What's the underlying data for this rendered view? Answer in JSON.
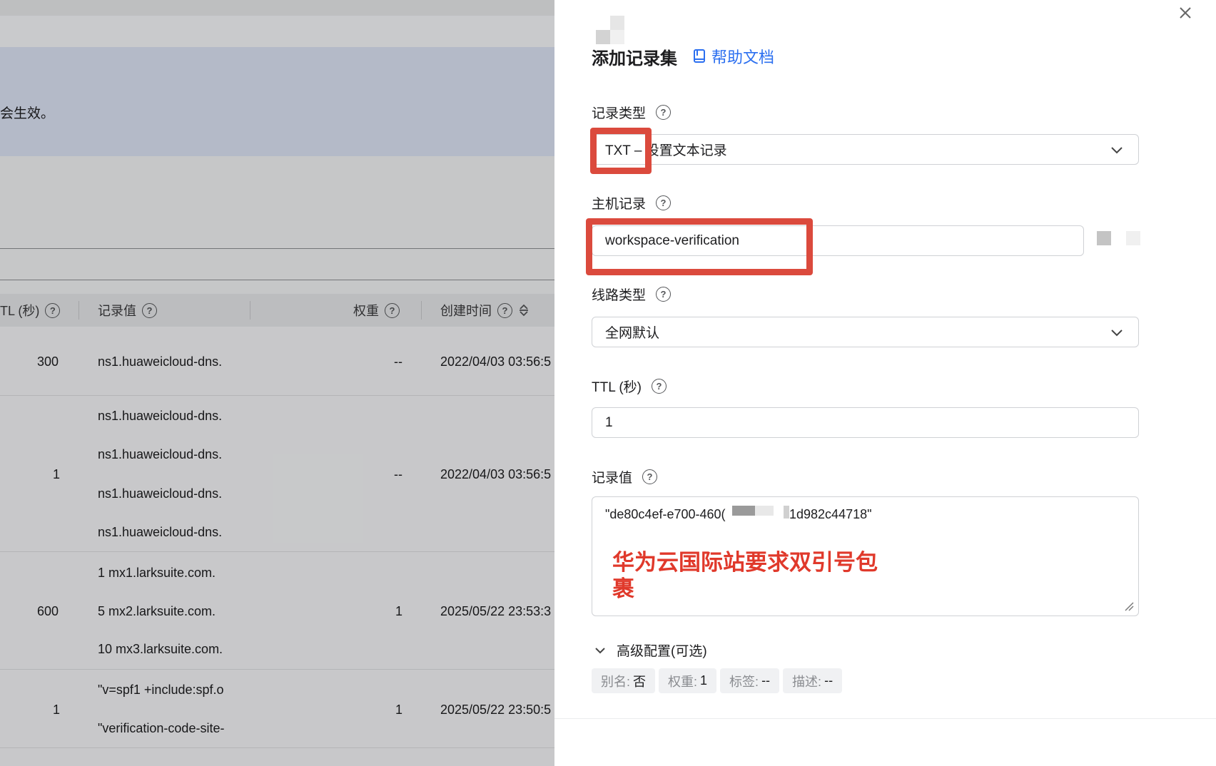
{
  "background": {
    "banner_text": "会生效。",
    "table": {
      "headers": {
        "ttl": "TL (秒)",
        "value": "记录值",
        "weight": "权重",
        "created": "创建时间"
      },
      "rows": [
        {
          "ttl": "300",
          "values": [
            "ns1.huaweicloud-dns."
          ],
          "weight": "--",
          "created": "2022/04/03 03:56:5"
        },
        {
          "ttl": "1",
          "values": [
            "ns1.huaweicloud-dns.",
            "ns1.huaweicloud-dns.",
            "ns1.huaweicloud-dns.",
            "ns1.huaweicloud-dns."
          ],
          "weight": "--",
          "created": "2022/04/03 03:56:5"
        },
        {
          "ttl": "600",
          "values": [
            "1 mx1.larksuite.com.",
            "5 mx2.larksuite.com.",
            "10 mx3.larksuite.com."
          ],
          "weight": "1",
          "created": "2025/05/22 23:53:3"
        },
        {
          "ttl": "1",
          "values": [
            "\"v=spf1 +include:spf.o",
            "\"verification-code-site-"
          ],
          "weight": "1",
          "created": "2025/05/22 23:50:5"
        }
      ]
    }
  },
  "drawer": {
    "title": "添加记录集",
    "help_link": "帮助文档",
    "fields": {
      "record_type": {
        "label": "记录类型",
        "value": "TXT – 设置文本记录"
      },
      "host": {
        "label": "主机记录",
        "value": "workspace-verification"
      },
      "line_type": {
        "label": "线路类型",
        "value": "全网默认"
      },
      "ttl": {
        "label": "TTL (秒)",
        "value": "1"
      },
      "record_value": {
        "label": "记录值",
        "value_start": "\"de80c4ef-e700-460(",
        "value_end": "1d982c44718\""
      }
    },
    "annotation": "华为云国际站要求双引号包裹",
    "advanced": {
      "label": "高级配置(可选)",
      "tags": [
        {
          "key": "别名:",
          "value": "否"
        },
        {
          "key": "权重:",
          "value": "1"
        },
        {
          "key": "标签:",
          "value": "--"
        },
        {
          "key": "描述:",
          "value": "--"
        }
      ]
    }
  },
  "colors": {
    "accent": "#2b6ff0",
    "highlight": "#db4a3d",
    "annotation": "#e0392b"
  }
}
